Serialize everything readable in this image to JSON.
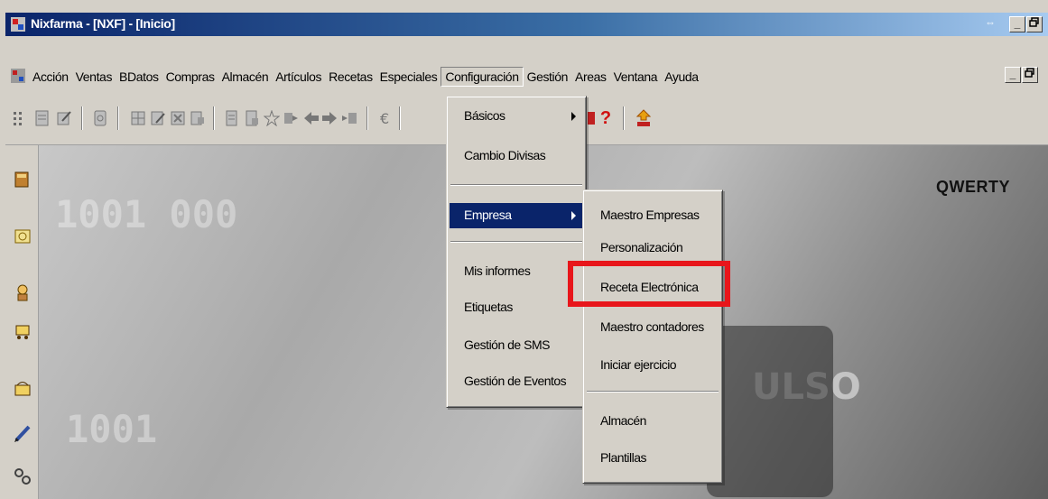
{
  "window": {
    "title": "Nixfarma - [NXF] - [Inicio]",
    "restore_glyph": "⇔",
    "minimize_glyph": "_",
    "maximize_glyph": "🗗"
  },
  "menubar": {
    "items": [
      "Acción",
      "Ventas",
      "BDatos",
      "Compras",
      "Almacén",
      "Artículos",
      "Recetas",
      "Especiales",
      "Configuración",
      "Gestión",
      "Areas",
      "Ventana",
      "Ayuda"
    ],
    "active": "Configuración"
  },
  "toolbar": {
    "help_glyph": "?"
  },
  "background": {
    "watermark": "QWERTY",
    "deco_text_1": "1001 000",
    "deco_text_2": "1001",
    "deco_text_3": "ULSO"
  },
  "config_menu": {
    "items": [
      {
        "label": "Básicos",
        "has_submenu": true
      },
      {
        "label": "Cambio Divisas",
        "has_submenu": false
      },
      {
        "label": "Empresa",
        "has_submenu": true,
        "highlighted": true
      },
      {
        "label": "Mis informes",
        "has_submenu": false
      },
      {
        "label": "Etiquetas",
        "has_submenu": false
      },
      {
        "label": "Gestión de SMS",
        "has_submenu": false
      },
      {
        "label": "Gestión de Eventos",
        "has_submenu": false
      }
    ]
  },
  "empresa_submenu": {
    "items": [
      {
        "label": "Maestro Empresas"
      },
      {
        "label": "Personalización"
      },
      {
        "label": "Receta Electrónica",
        "annotated": true
      },
      {
        "label": "Maestro contadores"
      },
      {
        "label": "Iniciar ejercicio"
      },
      {
        "label": "Almacén"
      },
      {
        "label": "Plantillas"
      }
    ]
  },
  "colors": {
    "titlebar_start": "#0a246a",
    "menu_highlight": "#0a246a",
    "annotation_box": "#e8161b",
    "chrome": "#d4d0c8"
  }
}
